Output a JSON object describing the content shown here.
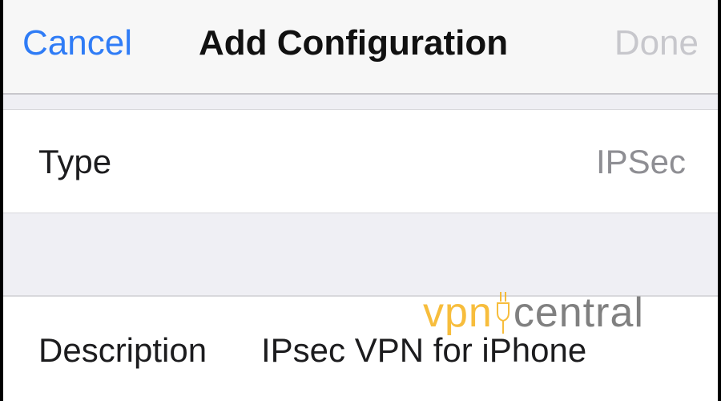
{
  "navbar": {
    "cancel_label": "Cancel",
    "title": "Add Configuration",
    "done_label": "Done"
  },
  "form": {
    "type": {
      "label": "Type",
      "value": "IPSec"
    },
    "description": {
      "label": "Description",
      "value": "IPsec VPN for iPhone"
    }
  },
  "watermark": {
    "part1": "vpn",
    "part2": "central"
  },
  "colors": {
    "accent": "#2f7cf6",
    "disabled": "#c7c7cc",
    "watermark_primary": "#f6b21b",
    "watermark_secondary": "#6b6b6b"
  }
}
